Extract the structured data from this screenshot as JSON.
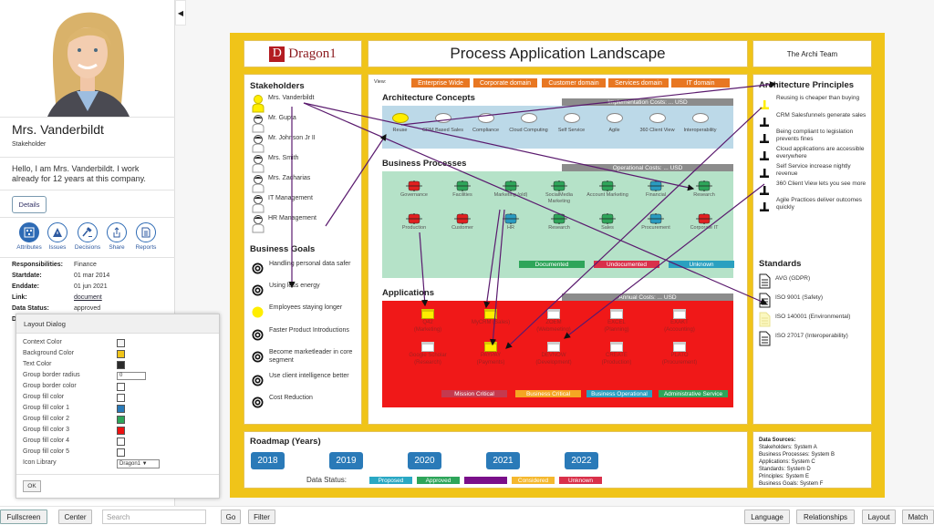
{
  "profile": {
    "name": "Mrs. Vanderbildt",
    "role": "Stakeholder",
    "bio": "Hello, I am Mrs. Vanderbildt. I work already for 12 years at this company.",
    "details_label": "Details",
    "actions": [
      {
        "label": "Attributes",
        "icon": "attributes-icon",
        "active": true
      },
      {
        "label": "Issues",
        "icon": "warning-icon",
        "active": false
      },
      {
        "label": "Decisions",
        "icon": "gavel-icon",
        "active": false
      },
      {
        "label": "Share",
        "icon": "share-icon",
        "active": false
      },
      {
        "label": "Reports",
        "icon": "report-icon",
        "active": false
      }
    ],
    "attributes": [
      {
        "key": "Responsibilities:",
        "value": "Finance"
      },
      {
        "key": "Startdate:",
        "value": "01 mar 2014"
      },
      {
        "key": "Enddate:",
        "value": "01 jun 2021"
      },
      {
        "key": "Link:",
        "value": "document",
        "link": true
      },
      {
        "key": "Data Status:",
        "value": "approved"
      },
      {
        "key": "D",
        "value": ""
      }
    ]
  },
  "collapse_icon": "◀",
  "dialog": {
    "title": "Layout Dialog",
    "rows": [
      {
        "label": "Context Color",
        "type": "swatch",
        "color": "#f4f4f4"
      },
      {
        "label": "Background Color",
        "type": "swatch",
        "color": "#f0c419"
      },
      {
        "label": "Text Color",
        "type": "swatch",
        "color": "#2b2b2b"
      },
      {
        "label": "Group border radius",
        "type": "input",
        "value": "0"
      },
      {
        "label": "Group border color",
        "type": "swatch",
        "color": "#ffffff"
      },
      {
        "label": "Group fill color",
        "type": "swatch",
        "color": "#ffffff"
      },
      {
        "label": "Group fill color 1",
        "type": "swatch",
        "color": "#2a7ab8"
      },
      {
        "label": "Group fill color 2",
        "type": "swatch",
        "color": "#2ea55a"
      },
      {
        "label": "Group fill color 3",
        "type": "swatch",
        "color": "#ee1111"
      },
      {
        "label": "Group fill color 4",
        "type": "swatch",
        "color": "#ffffff"
      },
      {
        "label": "Group fill color 5",
        "type": "swatch",
        "color": "#ffffff"
      },
      {
        "label": "Icon Library",
        "type": "select",
        "value": "Dragon1 ▼"
      }
    ],
    "ok_label": "OK"
  },
  "board": {
    "logo_letter": "D",
    "logo_text": "Dragon1",
    "title": "Process Application Landscape",
    "team": "The Archi Team",
    "stakeholders_title": "Stakeholders",
    "stakeholders": [
      {
        "name": "Mrs. Vanderbildt",
        "highlight": true
      },
      {
        "name": "Mr. Gupta",
        "highlight": false
      },
      {
        "name": "Mr. Johnson Jr II",
        "highlight": false
      },
      {
        "name": "Mrs. Smith",
        "highlight": false
      },
      {
        "name": "Mrs. Zacharias",
        "highlight": false
      },
      {
        "name": "IT Management",
        "highlight": false
      },
      {
        "name": "HR Management",
        "highlight": false
      }
    ],
    "goals_title": "Business Goals",
    "goals": [
      {
        "name": "Handling personal data safer",
        "highlight": false
      },
      {
        "name": "Using less energy",
        "highlight": false
      },
      {
        "name": "Employees staying longer",
        "highlight": true
      },
      {
        "name": "Faster Product Introductions",
        "highlight": false
      },
      {
        "name": "Become marketleader in core segment",
        "highlight": false
      },
      {
        "name": "Use client intelligence better",
        "highlight": false
      },
      {
        "name": "Cost Reduction",
        "highlight": false
      }
    ],
    "view_label": "View:",
    "views": [
      "Enterprise Wide",
      "Corporate domain",
      "Customer domain",
      "Services domain",
      "IT domain"
    ],
    "concepts_title": "Architecture Concepts",
    "concepts_cost": "Implementation Costs: ... USD",
    "concepts": [
      {
        "name": "Reuse",
        "highlight": true
      },
      {
        "name": "CRM Based Sales",
        "highlight": false
      },
      {
        "name": "Compliance",
        "highlight": false
      },
      {
        "name": "Cloud Computing",
        "highlight": false
      },
      {
        "name": "Self Service",
        "highlight": false
      },
      {
        "name": "Agile",
        "highlight": false
      },
      {
        "name": "360 Client View",
        "highlight": false
      },
      {
        "name": "Interoperability",
        "highlight": false
      }
    ],
    "processes_title": "Business Processes",
    "processes_cost": "Operational Costs: ... USD",
    "processes": [
      [
        {
          "name": "Governance",
          "status": "undocumented"
        },
        {
          "name": "Facilities",
          "status": "documented"
        },
        {
          "name": "Marketing (old)",
          "status": "documented"
        },
        {
          "name": "SocialMedia Marketing",
          "status": "documented"
        },
        {
          "name": "Account Marketing",
          "status": "documented"
        },
        {
          "name": "Financial",
          "status": "unknown"
        },
        {
          "name": "Research",
          "status": "documented"
        }
      ],
      [
        {
          "name": "Production",
          "status": "undocumented"
        },
        {
          "name": "Customer",
          "status": "undocumented"
        },
        {
          "name": "HR",
          "status": "unknown"
        },
        {
          "name": "Research",
          "status": "documented"
        },
        {
          "name": "Sales",
          "status": "documented"
        },
        {
          "name": "Procurement",
          "status": "unknown"
        },
        {
          "name": "Corporate IT",
          "status": "undocumented"
        }
      ]
    ],
    "process_legend": [
      {
        "label": "Documented",
        "color": "#2ea55a"
      },
      {
        "label": "Undocumented",
        "color": "#d9304a"
      },
      {
        "label": "Unknown",
        "color": "#2aa0c0"
      }
    ],
    "status_colors": {
      "documented": "#2ea55a",
      "undocumented": "#e02020",
      "unknown": "#2a9bc0"
    },
    "apps_title": "Applications",
    "apps_cost": "Annual Costs: ... USD",
    "apps": [
      [
        {
          "name": "Q42",
          "sub": "(Marketing)",
          "highlight": true
        },
        {
          "name": "MyCRM (Sales)",
          "sub": "",
          "highlight": true
        },
        {
          "name": "ZOEM",
          "sub": "(Webmeeting)",
          "highlight": false
        },
        {
          "name": "EXCEL",
          "sub": "(Planning)",
          "highlight": false
        },
        {
          "name": "EXAKT",
          "sub": "(Accounting)",
          "highlight": false
        }
      ],
      [
        {
          "name": "Google Scholar",
          "sub": "(Research)",
          "highlight": false
        },
        {
          "name": "PAYPAY",
          "sub": "(Payments)",
          "highlight": true
        },
        {
          "name": "DEVNOW",
          "sub": "(Development)",
          "highlight": false
        },
        {
          "name": "CREATE",
          "sub": "(Production)",
          "highlight": false
        },
        {
          "name": "PLATO",
          "sub": "(Procurement)",
          "highlight": false
        }
      ]
    ],
    "app_legend": [
      {
        "label": "Mission Critical",
        "color": "#c43a4e"
      },
      {
        "label": "Business Critical",
        "color": "#f5a623"
      },
      {
        "label": "Business Operational",
        "color": "#2aa0c0"
      },
      {
        "label": "Administrative Service",
        "color": "#2ea55a"
      }
    ],
    "principles_title": "Architecture Principles",
    "principles": [
      {
        "text": "Reusing is cheaper than buying",
        "highlight": true
      },
      {
        "text": "CRM Salesfunnels generate sales",
        "highlight": false
      },
      {
        "text": "Being compliant to legislation prevents fines",
        "highlight": false
      },
      {
        "text": "Cloud applications are accessible everywhere",
        "highlight": false
      },
      {
        "text": "Self Service increase nightly revenue",
        "highlight": false
      },
      {
        "text": "360 Client View lets you see more",
        "highlight": false
      },
      {
        "text": "Agile Practices deliver outcomes quickly",
        "highlight": false
      }
    ],
    "standards_title": "Standards",
    "standards": [
      {
        "text": "AVG (GDPR)",
        "highlight": false
      },
      {
        "text": "ISO 9001 (Safety)",
        "highlight": false
      },
      {
        "text": "ISO 140001 (Environmental)",
        "highlight": true
      },
      {
        "text": "ISO 27017 (Interoperability)",
        "highlight": false
      }
    ],
    "roadmap_title": "Roadmap (Years)",
    "years": [
      "2018",
      "2019",
      "2020",
      "2021",
      "2022"
    ],
    "data_status_label": "Data Status:",
    "data_status": [
      {
        "label": "Proposed",
        "color": "#2aa8c4"
      },
      {
        "label": "Approved",
        "color": "#2ea55a"
      },
      {
        "label": "",
        "color": "#7a0f8a"
      },
      {
        "label": "Considered",
        "color": "#f5b82e"
      },
      {
        "label": "Unknown",
        "color": "#d9304a"
      }
    ],
    "sources_title": "Data Sources:",
    "sources": [
      "Stakeholders: System A",
      "Business Processes: System B",
      "Applications: System C",
      "Standards: System D",
      "Principles: System E",
      "Business Goals: System F"
    ],
    "colors": {
      "background": "#f0c419",
      "concepts_fill": "#bcd9e8",
      "processes_fill": "#b5e2c8",
      "apps_fill": "#f01818",
      "highlight": "#ffee00",
      "view_button": "#e87722",
      "relation_line": "#5a1a6e"
    }
  },
  "toolbar": {
    "fullscreen": "Fullscreen",
    "center": "Center",
    "search_placeholder": "Search",
    "go": "Go",
    "filter": "Filter",
    "language": "Language",
    "relationships": "Relationships",
    "layout": "Layout",
    "match": "Match"
  }
}
